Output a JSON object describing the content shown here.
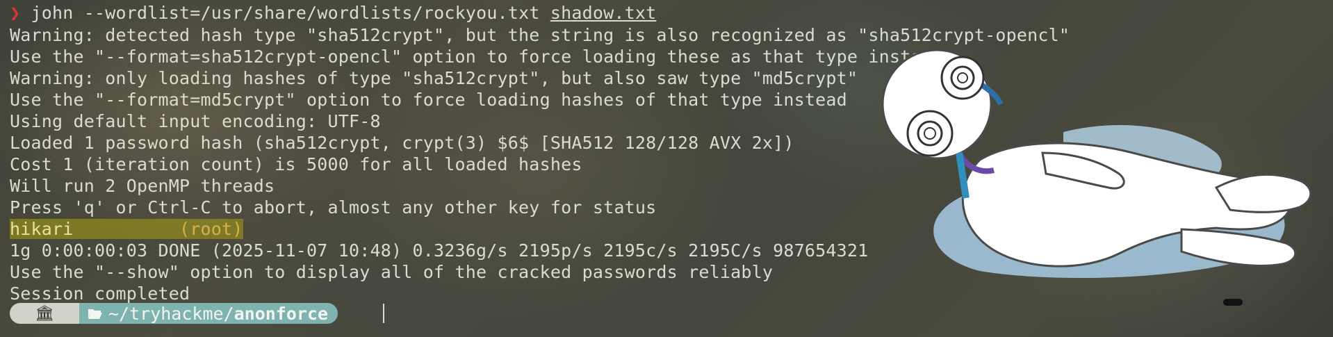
{
  "terminal": {
    "prompt_symbol": "❯",
    "command": "john --wordlist=/usr/share/wordlists/rockyou.txt ",
    "command_file": "shadow.txt",
    "output": [
      "Warning: detected hash type \"sha512crypt\", but the string is also recognized as \"sha512crypt-opencl\"",
      "Use the \"--format=sha512crypt-opencl\" option to force loading these as that type instead",
      "Warning: only loading hashes of type \"sha512crypt\", but also saw type \"md5crypt\"",
      "Use the \"--format=md5crypt\" option to force loading hashes of that type instead",
      "Using default input encoding: UTF-8",
      "Loaded 1 password hash (sha512crypt, crypt(3) $6$ [SHA512 128/128 AVX 2x])",
      "Cost 1 (iteration count) is 5000 for all loaded hashes",
      "Will run 2 OpenMP threads",
      "Press 'q' or Ctrl-C to abort, almost any other key for status"
    ],
    "cracked_password": "hikari",
    "cracked_spacing": "          ",
    "cracked_user": "(root)",
    "output_after": [
      "1g 0:00:00:03 DONE (2025-11-07 10:48) 0.3236g/s 2195p/s 2195c/s 2195C/s 987654321",
      "Use the \"--show\" option to display all of the cracked passwords reliably",
      "Session completed"
    ]
  },
  "prompt_bar": {
    "home_icon": "bank-icon",
    "home_glyph": "🏛",
    "folder_icon": "folder-open-icon",
    "path_prefix": "~/tryhackme/",
    "path_current": "anonforce"
  },
  "colors": {
    "prompt_arrow": "#e0303a",
    "text": "#d9dccf",
    "highlight": "#aaa014",
    "path_segment": "#7fb3b0",
    "home_segment": "#cfd3c9"
  },
  "overlay": {
    "icon": "astronaut-sticker-icon"
  }
}
